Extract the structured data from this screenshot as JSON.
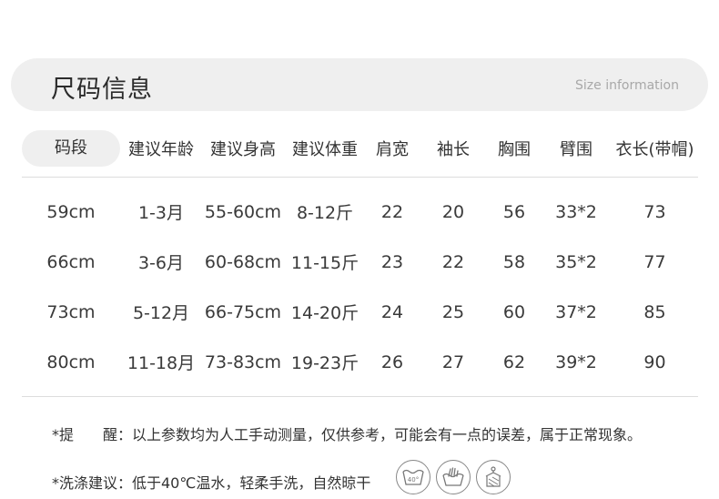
{
  "header": {
    "title": "尺码信息",
    "subtitle": "Size information"
  },
  "table": {
    "columns": [
      "码段",
      "建议年龄",
      "建议身高",
      "建议体重",
      "肩宽",
      "袖长",
      "胸围",
      "臂围",
      "衣长(带帽)"
    ],
    "rows": [
      [
        "59cm",
        "1-3月",
        "55-60cm",
        "8-12斤",
        "22",
        "20",
        "56",
        "33*2",
        "73"
      ],
      [
        "66cm",
        "3-6月",
        "60-68cm",
        "11-15斤",
        "23",
        "22",
        "58",
        "35*2",
        "77"
      ],
      [
        "73cm",
        "5-12月",
        "66-75cm",
        "14-20斤",
        "24",
        "25",
        "60",
        "37*2",
        "85"
      ],
      [
        "80cm",
        "11-18月",
        "73-83cm",
        "19-23斤",
        "26",
        "27",
        "62",
        "39*2",
        "90"
      ]
    ]
  },
  "notes": {
    "reminder": "*提　　醒：以上参数均为人工手动测量，仅供参考，可能会有一点的误差，属于正常现象。",
    "wash": "*洗涤建议：低于40℃温水，轻柔手洗，自然晾干"
  },
  "care_icons": [
    {
      "name": "wash-40-icon",
      "label": "40°"
    },
    {
      "name": "hand-wash-icon"
    },
    {
      "name": "hang-dry-icon"
    }
  ]
}
